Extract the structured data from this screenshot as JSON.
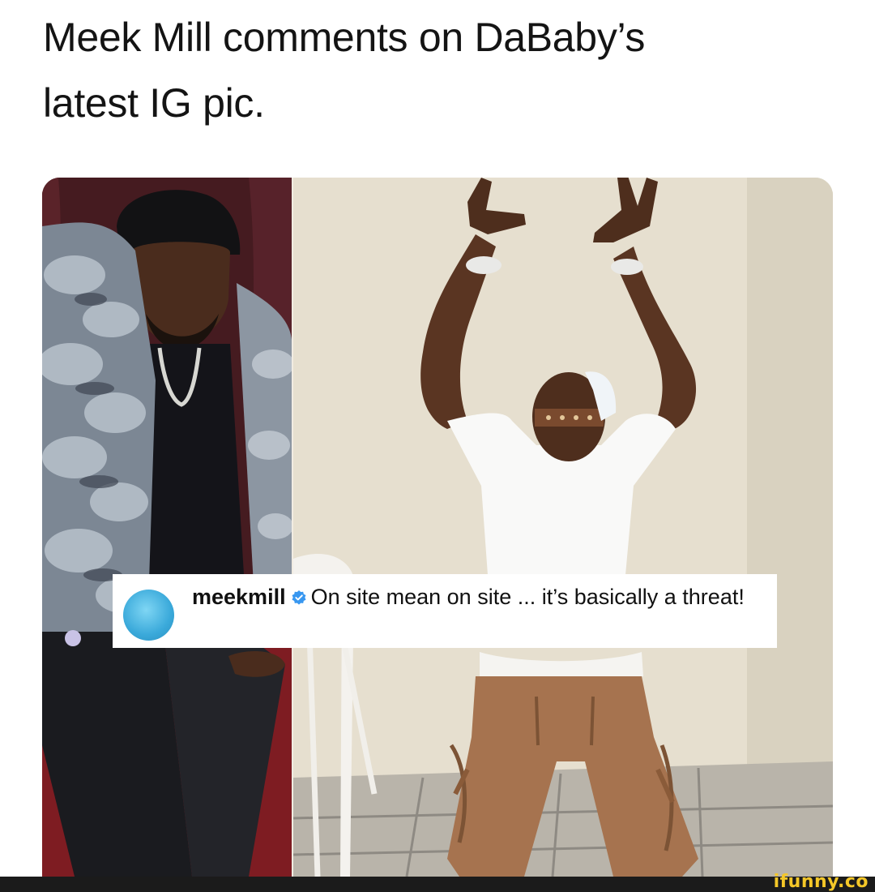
{
  "headline": {
    "line1": "Meek Mill comments on DaBaby’s",
    "line2": "latest IG pic."
  },
  "comment": {
    "username": "meekmill",
    "verified_icon": "verified-badge-icon",
    "text": "On site mean on site ... it’s basically a threat!",
    "avatar_icon": "profile-avatar-icon"
  },
  "watermark": {
    "text": "ifunny.co",
    "color": "#f4c728"
  },
  "colors": {
    "headline_text": "#141414",
    "verified_badge": "#3897f0",
    "bottom_bar": "#1b1b1b"
  }
}
